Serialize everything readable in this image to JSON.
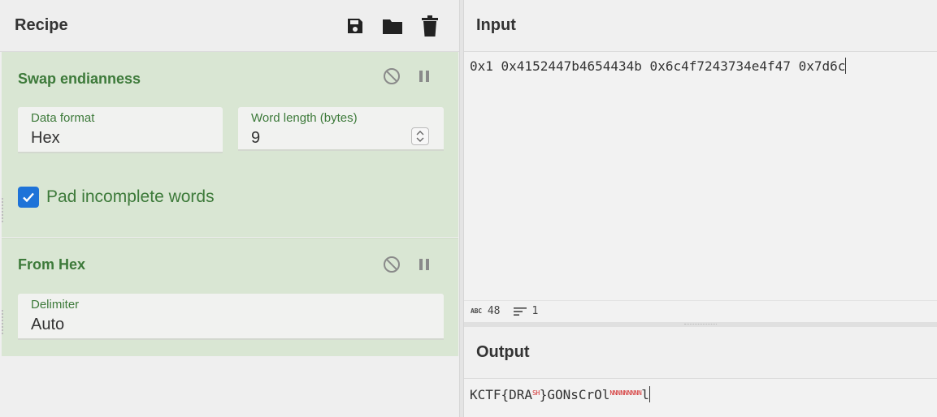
{
  "recipe": {
    "title": "Recipe",
    "tools": [
      "save-icon",
      "folder-open-icon",
      "trash-icon"
    ],
    "operations": [
      {
        "name": "Swap endianness",
        "fields": {
          "data_format_label": "Data format",
          "data_format_value": "Hex",
          "word_length_label": "Word length (bytes)",
          "word_length_value": "9"
        },
        "checkbox_label": "Pad incomplete words",
        "checkbox_checked": true
      },
      {
        "name": "From Hex",
        "fields": {
          "delimiter_label": "Delimiter",
          "delimiter_value": "Auto"
        }
      }
    ]
  },
  "input": {
    "title": "Input",
    "text": "0x1 0x4152447b4654434b 0x6c4f7243734e4f47 0x7d6c",
    "status": {
      "length": "48",
      "lines": "1"
    }
  },
  "output": {
    "title": "Output",
    "prefix": "KCTF{DRA",
    "ctrl1": "SH",
    "middle": "}GONsCrOl",
    "ctrl2": "NNNNNNNNN",
    "suffix": "l"
  },
  "colors": {
    "op_bg": "#d9e6d3",
    "op_text": "#3d7a3a",
    "checkbox": "#1e73d8",
    "ctrl_char": "#d32f2f"
  }
}
